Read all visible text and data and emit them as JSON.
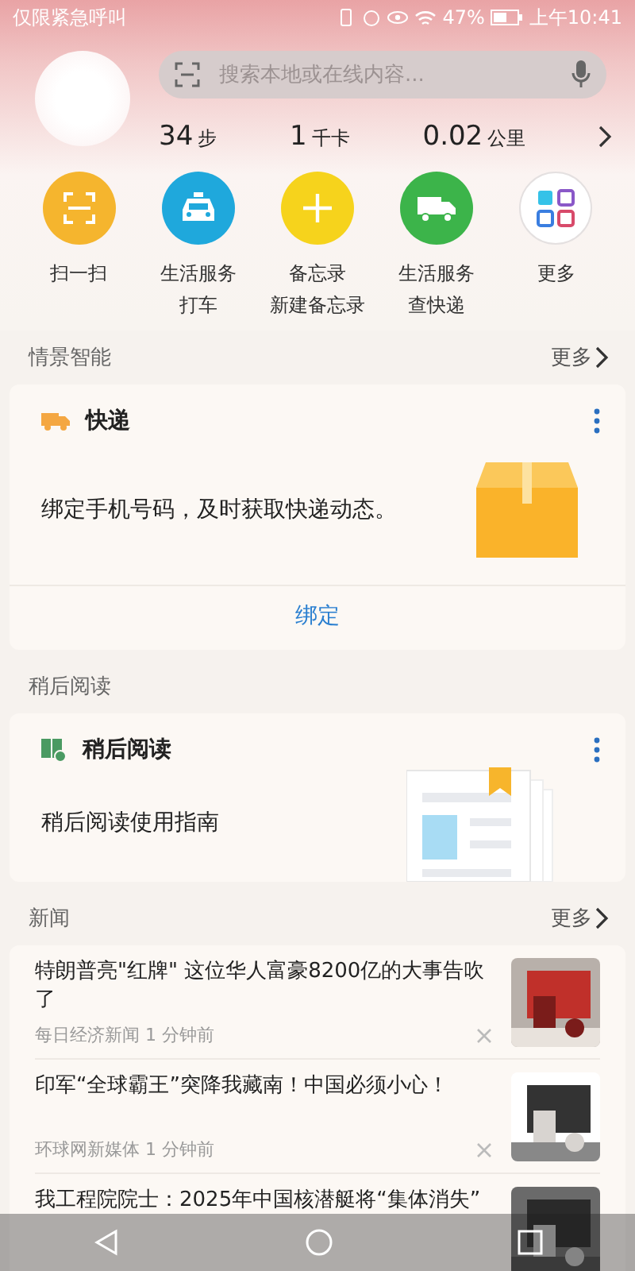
{
  "status_bar": {
    "carrier": "仅限紧急呼叫",
    "battery": "47%",
    "time": "上午10:41"
  },
  "search": {
    "placeholder": "搜索本地或在线内容..."
  },
  "stats": [
    {
      "value": "34",
      "unit": "步"
    },
    {
      "value": "1",
      "unit": "千卡"
    },
    {
      "value": "0.02",
      "unit": "公里"
    }
  ],
  "shortcuts": [
    {
      "kind": "scan",
      "color": "#f5b52e",
      "label": "扫一扫"
    },
    {
      "kind": "taxi",
      "color": "#1fa8dc",
      "label": "生活服务",
      "sublabel": "打车"
    },
    {
      "kind": "memo",
      "color": "#f6d31c",
      "label": "备忘录",
      "sublabel": "新建备忘录"
    },
    {
      "kind": "delivery",
      "color": "#3cb44a",
      "label": "生活服务",
      "sublabel": "查快递"
    },
    {
      "kind": "more",
      "color": "#ffffff",
      "label": "更多"
    }
  ],
  "scene": {
    "title": "情景智能",
    "more": "更多",
    "card": {
      "title": "快递",
      "text": "绑定手机号码，及时获取快递动态。",
      "action": "绑定"
    }
  },
  "read_later": {
    "title": "稍后阅读",
    "card": {
      "title": "稍后阅读",
      "text": "稍后阅读使用指南"
    }
  },
  "news": {
    "title": "新闻",
    "more": "更多",
    "items": [
      {
        "title": "特朗普亮\"红牌\" 这位华人富豪8200亿的大事告吹了",
        "source": "每日经济新闻",
        "time": "1 分钟前"
      },
      {
        "title": "印军“全球霸王”突降我藏南！中国必须小心！",
        "source": "环球网新媒体",
        "time": "1 分钟前"
      },
      {
        "title": "我工程院院士：2025年中国核潜艇将“集体消失”"
      }
    ]
  }
}
